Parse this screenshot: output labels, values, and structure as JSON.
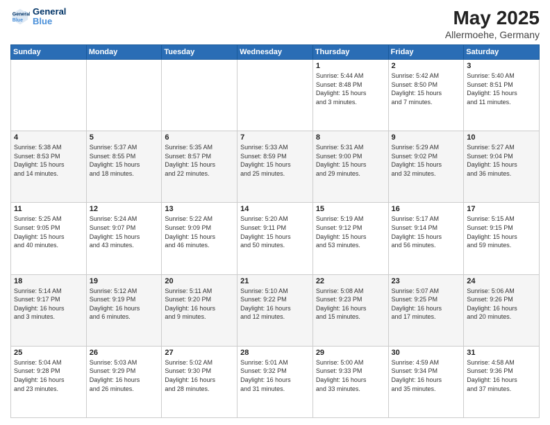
{
  "logo": {
    "text1": "General",
    "text2": "Blue"
  },
  "title": "May 2025",
  "subtitle": "Allermoehe, Germany",
  "days": [
    "Sunday",
    "Monday",
    "Tuesday",
    "Wednesday",
    "Thursday",
    "Friday",
    "Saturday"
  ],
  "weeks": [
    [
      {
        "day": "",
        "info": ""
      },
      {
        "day": "",
        "info": ""
      },
      {
        "day": "",
        "info": ""
      },
      {
        "day": "",
        "info": ""
      },
      {
        "day": "1",
        "info": "Sunrise: 5:44 AM\nSunset: 8:48 PM\nDaylight: 15 hours\nand 3 minutes."
      },
      {
        "day": "2",
        "info": "Sunrise: 5:42 AM\nSunset: 8:50 PM\nDaylight: 15 hours\nand 7 minutes."
      },
      {
        "day": "3",
        "info": "Sunrise: 5:40 AM\nSunset: 8:51 PM\nDaylight: 15 hours\nand 11 minutes."
      }
    ],
    [
      {
        "day": "4",
        "info": "Sunrise: 5:38 AM\nSunset: 8:53 PM\nDaylight: 15 hours\nand 14 minutes."
      },
      {
        "day": "5",
        "info": "Sunrise: 5:37 AM\nSunset: 8:55 PM\nDaylight: 15 hours\nand 18 minutes."
      },
      {
        "day": "6",
        "info": "Sunrise: 5:35 AM\nSunset: 8:57 PM\nDaylight: 15 hours\nand 22 minutes."
      },
      {
        "day": "7",
        "info": "Sunrise: 5:33 AM\nSunset: 8:59 PM\nDaylight: 15 hours\nand 25 minutes."
      },
      {
        "day": "8",
        "info": "Sunrise: 5:31 AM\nSunset: 9:00 PM\nDaylight: 15 hours\nand 29 minutes."
      },
      {
        "day": "9",
        "info": "Sunrise: 5:29 AM\nSunset: 9:02 PM\nDaylight: 15 hours\nand 32 minutes."
      },
      {
        "day": "10",
        "info": "Sunrise: 5:27 AM\nSunset: 9:04 PM\nDaylight: 15 hours\nand 36 minutes."
      }
    ],
    [
      {
        "day": "11",
        "info": "Sunrise: 5:25 AM\nSunset: 9:05 PM\nDaylight: 15 hours\nand 40 minutes."
      },
      {
        "day": "12",
        "info": "Sunrise: 5:24 AM\nSunset: 9:07 PM\nDaylight: 15 hours\nand 43 minutes."
      },
      {
        "day": "13",
        "info": "Sunrise: 5:22 AM\nSunset: 9:09 PM\nDaylight: 15 hours\nand 46 minutes."
      },
      {
        "day": "14",
        "info": "Sunrise: 5:20 AM\nSunset: 9:11 PM\nDaylight: 15 hours\nand 50 minutes."
      },
      {
        "day": "15",
        "info": "Sunrise: 5:19 AM\nSunset: 9:12 PM\nDaylight: 15 hours\nand 53 minutes."
      },
      {
        "day": "16",
        "info": "Sunrise: 5:17 AM\nSunset: 9:14 PM\nDaylight: 15 hours\nand 56 minutes."
      },
      {
        "day": "17",
        "info": "Sunrise: 5:15 AM\nSunset: 9:15 PM\nDaylight: 15 hours\nand 59 minutes."
      }
    ],
    [
      {
        "day": "18",
        "info": "Sunrise: 5:14 AM\nSunset: 9:17 PM\nDaylight: 16 hours\nand 3 minutes."
      },
      {
        "day": "19",
        "info": "Sunrise: 5:12 AM\nSunset: 9:19 PM\nDaylight: 16 hours\nand 6 minutes."
      },
      {
        "day": "20",
        "info": "Sunrise: 5:11 AM\nSunset: 9:20 PM\nDaylight: 16 hours\nand 9 minutes."
      },
      {
        "day": "21",
        "info": "Sunrise: 5:10 AM\nSunset: 9:22 PM\nDaylight: 16 hours\nand 12 minutes."
      },
      {
        "day": "22",
        "info": "Sunrise: 5:08 AM\nSunset: 9:23 PM\nDaylight: 16 hours\nand 15 minutes."
      },
      {
        "day": "23",
        "info": "Sunrise: 5:07 AM\nSunset: 9:25 PM\nDaylight: 16 hours\nand 17 minutes."
      },
      {
        "day": "24",
        "info": "Sunrise: 5:06 AM\nSunset: 9:26 PM\nDaylight: 16 hours\nand 20 minutes."
      }
    ],
    [
      {
        "day": "25",
        "info": "Sunrise: 5:04 AM\nSunset: 9:28 PM\nDaylight: 16 hours\nand 23 minutes."
      },
      {
        "day": "26",
        "info": "Sunrise: 5:03 AM\nSunset: 9:29 PM\nDaylight: 16 hours\nand 26 minutes."
      },
      {
        "day": "27",
        "info": "Sunrise: 5:02 AM\nSunset: 9:30 PM\nDaylight: 16 hours\nand 28 minutes."
      },
      {
        "day": "28",
        "info": "Sunrise: 5:01 AM\nSunset: 9:32 PM\nDaylight: 16 hours\nand 31 minutes."
      },
      {
        "day": "29",
        "info": "Sunrise: 5:00 AM\nSunset: 9:33 PM\nDaylight: 16 hours\nand 33 minutes."
      },
      {
        "day": "30",
        "info": "Sunrise: 4:59 AM\nSunset: 9:34 PM\nDaylight: 16 hours\nand 35 minutes."
      },
      {
        "day": "31",
        "info": "Sunrise: 4:58 AM\nSunset: 9:36 PM\nDaylight: 16 hours\nand 37 minutes."
      }
    ]
  ]
}
